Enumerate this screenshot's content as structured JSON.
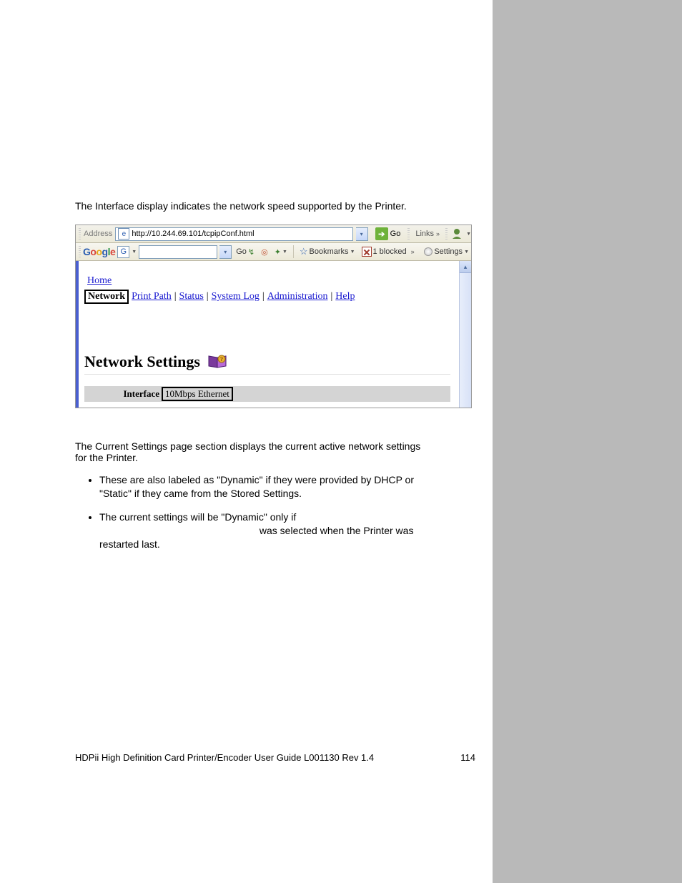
{
  "intro": "The Interface display indicates the network speed supported by the Printer.",
  "addrbar": {
    "label": "Address",
    "url": "http://10.244.69.101/tcpipConf.html",
    "go": "Go",
    "links": "Links"
  },
  "gbar": {
    "go": "Go",
    "bookmarks": "Bookmarks",
    "blocked": "1 blocked",
    "settings": "Settings"
  },
  "nav": {
    "home": "Home",
    "network": "Network",
    "print_path": "Print Path",
    "status": "Status",
    "system_log": "System Log",
    "administration": "Administration",
    "help": "Help"
  },
  "heading": "Network Settings",
  "interface": {
    "label": "Interface",
    "value": "10Mbps Ethernet"
  },
  "paras": {
    "p1": "The Current Settings page section displays the current active network settings for the Printer.",
    "b1": "These are also labeled as \"Dynamic\" if they were provided by DHCP or \"Static\" if they came from the Stored Settings.",
    "b2a": "The current settings will be \"Dynamic\" only if ",
    "b2b": " was selected when the Printer was restarted last."
  },
  "footer": {
    "left": "HDPii High Definition Card Printer/Encoder User Guide    L001130 Rev 1.4",
    "page": "114"
  }
}
